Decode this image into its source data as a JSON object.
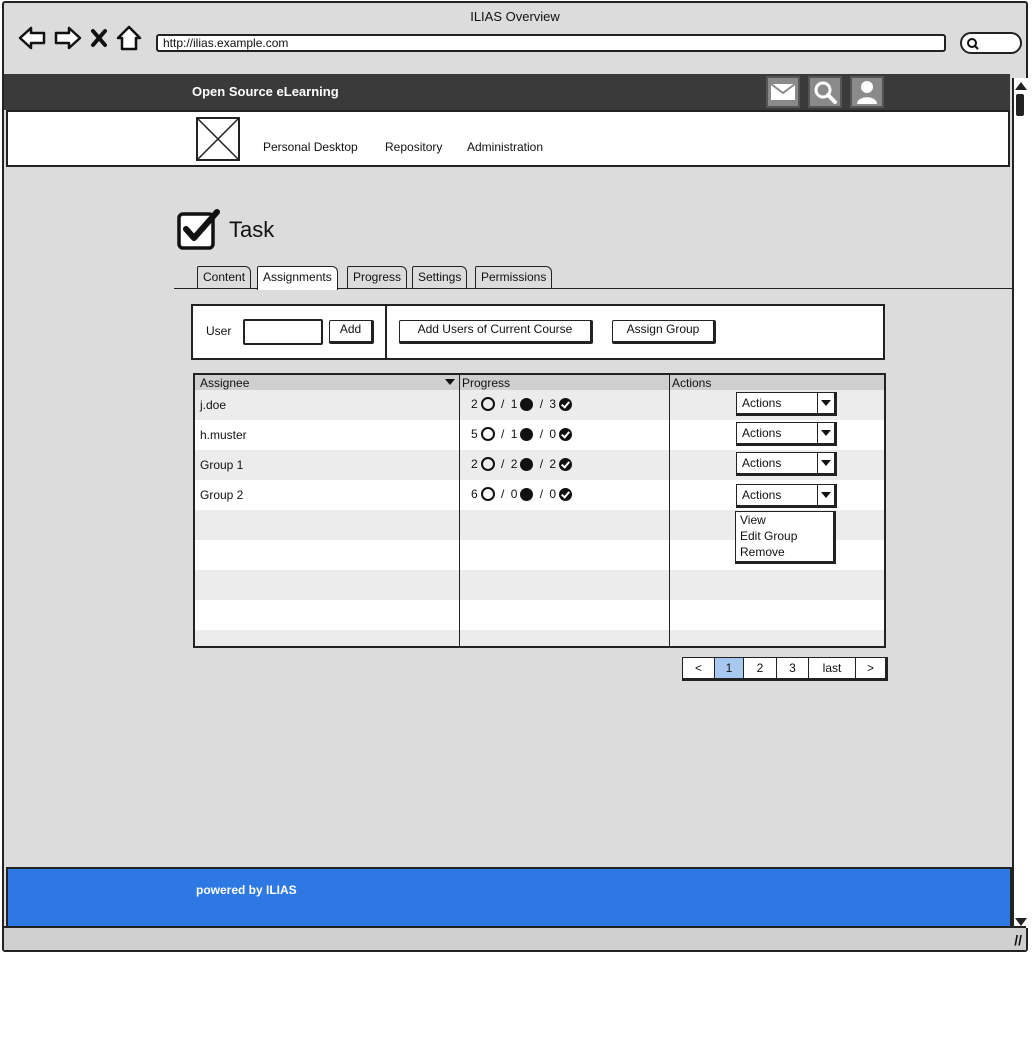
{
  "browser": {
    "title": "ILIAS Overview",
    "url": "http://ilias.example.com"
  },
  "header": {
    "brand": "Open Source eLearning",
    "icons": [
      "mail-icon",
      "search-icon",
      "user-icon"
    ]
  },
  "mainnav": {
    "items": [
      "Personal Desktop",
      "Repository",
      "Administration"
    ]
  },
  "page": {
    "title": "Task"
  },
  "tabs": [
    {
      "label": "Content",
      "active": false
    },
    {
      "label": "Assignments",
      "active": true
    },
    {
      "label": "Progress",
      "active": false
    },
    {
      "label": "Settings",
      "active": false
    },
    {
      "label": "Permissions",
      "active": false
    }
  ],
  "toolbar": {
    "user_label": "User",
    "user_value": "",
    "add_label": "Add",
    "add_users_label": "Add Users of Current Course",
    "assign_group_label": "Assign Group"
  },
  "table": {
    "columns": [
      "Assignee",
      "Progress",
      "Actions"
    ],
    "rows": [
      {
        "assignee": "j.doe",
        "open": "2",
        "in_progress": "1",
        "done": "3",
        "action": "Actions"
      },
      {
        "assignee": "h.muster",
        "open": "5",
        "in_progress": "1",
        "done": "0",
        "action": "Actions"
      },
      {
        "assignee": "Group 1",
        "open": "2",
        "in_progress": "2",
        "done": "2",
        "action": "Actions"
      },
      {
        "assignee": "Group 2",
        "open": "6",
        "in_progress": "0",
        "done": "0",
        "action": "Actions"
      }
    ],
    "open_menu": [
      "View",
      "Edit Group",
      "Remove"
    ]
  },
  "pagination": {
    "prev": "<",
    "pages": [
      "1",
      "2",
      "3"
    ],
    "current": "1",
    "last": "last",
    "next": ">"
  },
  "footer": {
    "text": "powered by ILIAS"
  },
  "colors": {
    "topbar": "#3a3a3a",
    "footer": "#2d78e3",
    "current_page": "#a8c8f0"
  }
}
